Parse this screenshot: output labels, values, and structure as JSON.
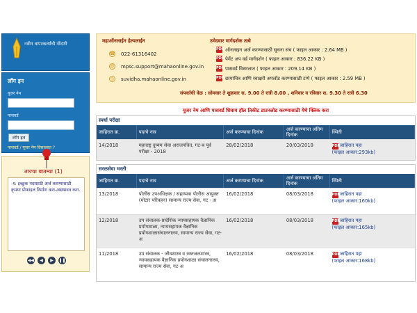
{
  "sidebar": {
    "new_user_label": "नवीन वापरकर्त्यांची नोंदणी",
    "login_title": "लॉग इन",
    "username_label": "यूजर नेम",
    "password_label": "पासवर्ड",
    "login_button": "लॉग इन",
    "forgot_link": "पासवर्ड / यूजर नेम विसरलात ?",
    "notice_title": "ताज्या बातम्या (1)",
    "notice_text": "-१: इच्छुक पदासाठी अर्ज करण्यासाठी कृपया प्रोफाइल निर्माण करा-अद्ययावत करा.",
    "controls": [
      "◀◀",
      "◀",
      "▶",
      "❚❚"
    ]
  },
  "helpline": {
    "title": "महाऑनलाईन हेल्पलाईन",
    "phone": "022-61316402",
    "email": "mpsc.support@mahaonline.gov.in",
    "site": "suvidha.mahaonline.gov.in",
    "guide_title": "उमेदवार मार्गदर्शक तत्वे",
    "guides": [
      "ऑनलाइन अर्ज करण्यासाठी सूचना संच ( फाइल आकार : 2.64 MB )",
      "पेमेंट अप वर्ड मार्गदर्शन ( फाइल आकार : 836.22 KB )",
      "पासवर्ड विसरलात ( फाइल आकार : 209.14 KB )",
      "छायाचित्र आणि स्वाक्षरी अपलोड करण्यासाठी टप्पे ( फाइल आकार : 2.59 MB )"
    ],
    "hours": "संपर्काची वेळ : सोमवार ते शुक्रवार स. 9.00 ते रात्री 8.00 , शनिवार व रविवार स. 9.30 ते रात्री 6.30"
  },
  "notice_red": "युजर नेम आणि पासवर्ड शिवाय हॉल तिकीट डाउनलोड करण्यासाठी येथे क्लिक करा",
  "headers": [
    "जाहिरात क्र.",
    "पदाचे नाव",
    "अर्ज करण्याचा दिनांक",
    "अर्ज करण्याचा अंतिम दिनांक",
    "स्थिती"
  ],
  "sections": [
    {
      "title": "स्पर्धा परीक्षा",
      "rows": [
        {
          "no": "14/2018",
          "name": "महाराष्ट्र दुय्यम सेवा अराजपत्रित, गट-ब पूर्व परीक्षा - 2018",
          "start": "28/02/2018",
          "end": "20/03/2018",
          "status": "जाहिरात पहा",
          "size": "(फाइल आकार:293kb)"
        }
      ]
    },
    {
      "title": "सरळसेवा भरती",
      "rows": [
        {
          "no": "13/2018",
          "name": "पोलीस उपअधिक्षक / सहाय्यक पोलीस आयुक्त (मोटार परिवहन) सामान्य राज्य सेवा, गट - अ",
          "start": "16/02/2018",
          "end": "08/03/2018",
          "status": "जाहिरात पहा",
          "size": "(फाइल आकार:160kb)"
        },
        {
          "no": "12/2018",
          "name": "उप संचालक-प्रादेशिक न्यायसहायक वैज्ञानिक प्रयोगशाळा, न्यायसहायक वैज्ञानिक प्रयोगशाळासंचालनालय, सामान्य राज्य सेवा, गट-अ",
          "start": "16/02/2018",
          "end": "08/03/2018",
          "status": "जाहिरात पहा",
          "size": "(फाइल आकार:165kb)"
        },
        {
          "no": "11/2018",
          "name": "उप संचालक - जीवशास्त्र व रक्तजलशास्त्र, न्यायसहायक वैज्ञानिक प्रयोगशाळा संचालनालय, सामान्य राज्य सेवा, गट-अ",
          "start": "16/02/2018",
          "end": "08/03/2018",
          "status": "जाहिरात पहा",
          "size": "(फाइल आकार:168kb)"
        }
      ]
    }
  ]
}
